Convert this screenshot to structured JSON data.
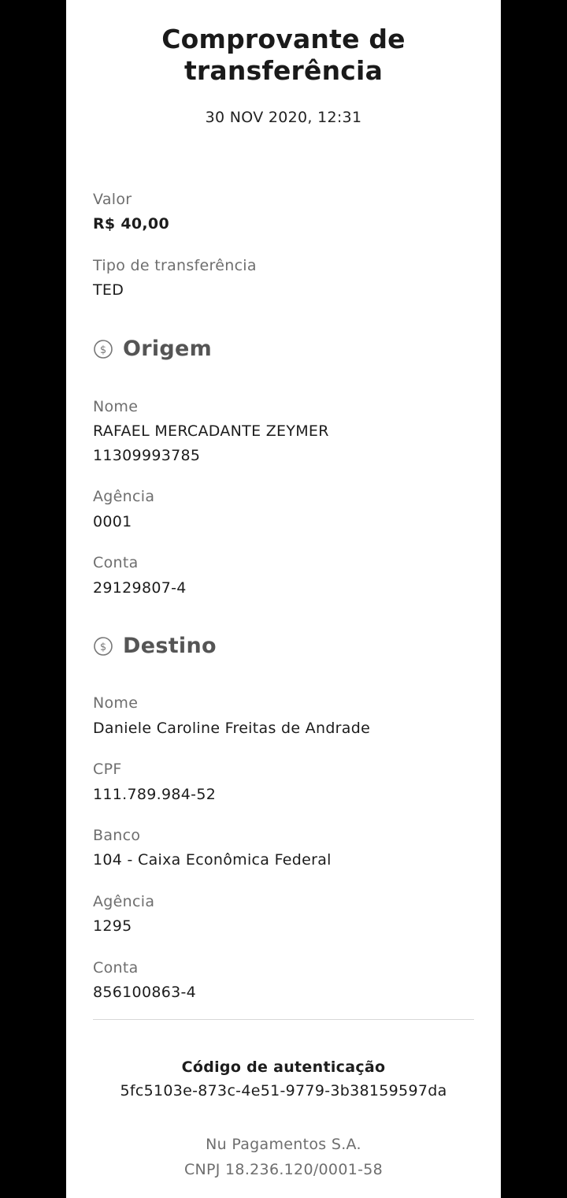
{
  "header": {
    "logo_icon": "nu-logo-icon",
    "title": "Comprovante de transferência",
    "date": "30 NOV 2020, 12:31"
  },
  "summary": {
    "valor_label": "Valor",
    "valor": "R$ 40,00",
    "tipo_label": "Tipo de transferência",
    "tipo": "TED"
  },
  "origem": {
    "icon": "money-circle-icon",
    "title": "Origem",
    "nome_label": "Nome",
    "nome": "RAFAEL MERCADANTE ZEYMER",
    "documento": "11309993785",
    "agencia_label": "Agência",
    "agencia": "0001",
    "conta_label": "Conta",
    "conta": "29129807-4"
  },
  "destino": {
    "icon": "money-circle-icon",
    "title": "Destino",
    "nome_label": "Nome",
    "nome": "Daniele Caroline Freitas de Andrade",
    "cpf_label": "CPF",
    "cpf": "111.789.984-52",
    "banco_label": "Banco",
    "banco": "104 - Caixa Econômica Federal",
    "agencia_label": "Agência",
    "agencia": "1295",
    "conta_label": "Conta",
    "conta": "856100863-4"
  },
  "footer": {
    "auth_label": "Código de autenticação",
    "auth_code": "5fc5103e-873c-4e51-9779-3b38159597da",
    "company": "Nu Pagamentos S.A.",
    "cnpj": "CNPJ 18.236.120/0001-58"
  },
  "colors": {
    "background": "#000000",
    "card": "#ffffff",
    "label": "#6e6e6e",
    "value": "#1c1c1c",
    "section_title": "#555555"
  }
}
